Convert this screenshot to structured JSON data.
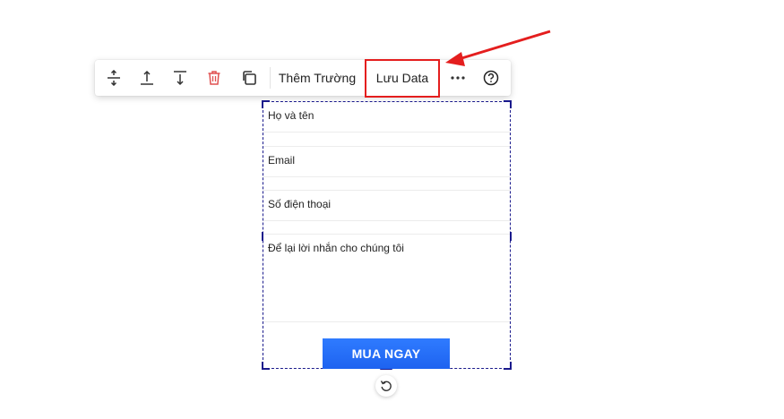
{
  "toolbar": {
    "icons": {
      "move_between": "move-between-icon",
      "move_up": "move-up-icon",
      "move_down": "move-down-icon",
      "delete": "trash-icon",
      "duplicate": "duplicate-icon",
      "more": "more-icon",
      "help": "help-icon"
    },
    "add_field_label": "Thêm Trường",
    "save_data_label": "Lưu Data"
  },
  "form": {
    "fields": [
      {
        "label": "Họ và tên"
      },
      {
        "label": "Email"
      },
      {
        "label": "Số điện thoại"
      },
      {
        "label": "Để lại lời nhắn cho chúng tôi"
      }
    ],
    "submit_label": "MUA NGAY"
  },
  "colors": {
    "annotation_red": "#e41e1e",
    "selection_border": "#1a1a8c",
    "button_blue": "#1e63f0",
    "delete_red": "#e05050"
  }
}
